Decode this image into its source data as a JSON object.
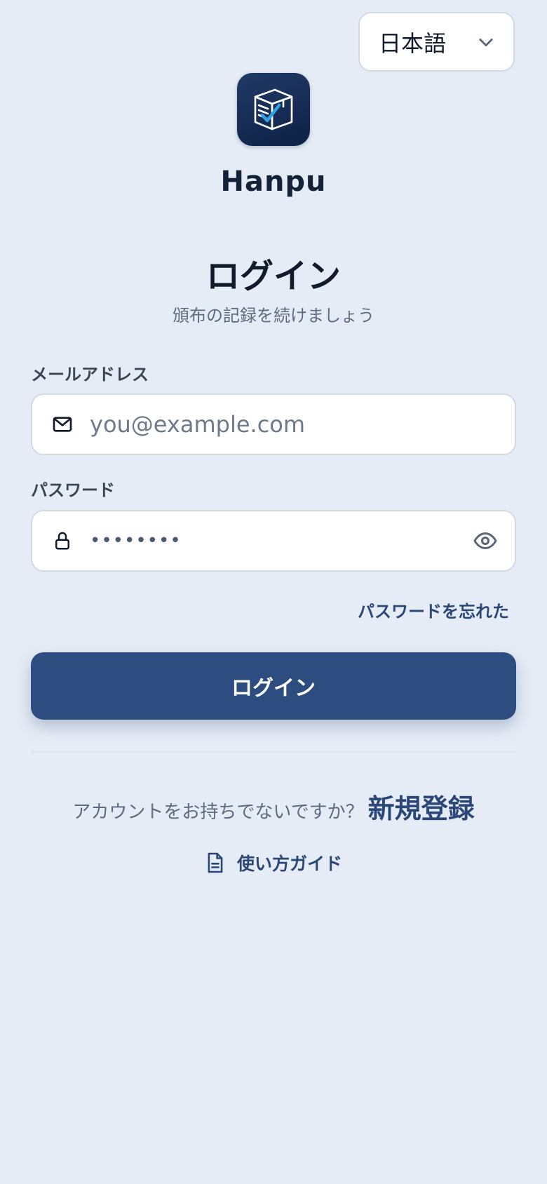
{
  "language_selector": {
    "value": "日本語",
    "icon": "chevron-down-icon"
  },
  "app": {
    "name": "Hanpu",
    "icon": "box-checklist-icon"
  },
  "header": {
    "title": "ログイン",
    "subtitle": "頒布の記録を続けましょう"
  },
  "form": {
    "email": {
      "label": "メールアドレス",
      "placeholder": "you@example.com",
      "value": "",
      "icon": "mail-icon"
    },
    "password": {
      "label": "パスワード",
      "masked_value": "••••••••",
      "icon": "lock-icon",
      "toggle_icon": "eye-icon"
    },
    "forgot_password": "パスワードを忘れた",
    "submit_label": "ログイン"
  },
  "signup": {
    "prompt": "アカウントをお持ちでないですか？",
    "link": "新規登録"
  },
  "guide": {
    "label": "使い方ガイド",
    "icon": "document-icon"
  },
  "colors": {
    "background": "#e6ecf5",
    "primary": "#2d4c7f",
    "link": "#2a4778",
    "app_icon_bg": "#14284f",
    "accent_check": "#2fa4e7"
  }
}
